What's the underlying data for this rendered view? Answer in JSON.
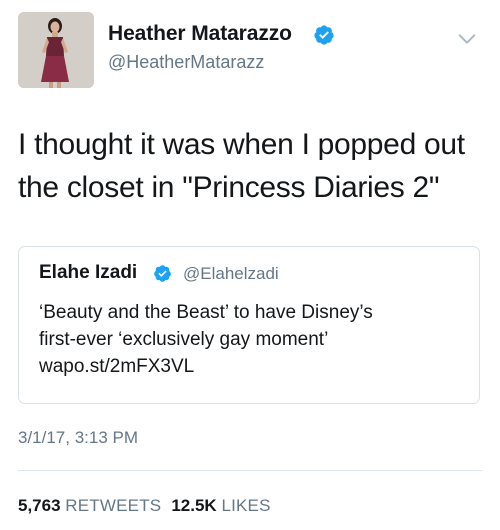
{
  "author": {
    "name": "Heather Matarazzo",
    "handle": "@HeatherMatarazz",
    "verified": true
  },
  "tweet": {
    "text": "I thought it was when I popped out\nthe closet in \"Princess Diaries 2\""
  },
  "quoted_tweet": {
    "name": "Elahe Izadi",
    "handle": "@Elahelzadi",
    "verified": true,
    "text": "‘Beauty and the Beast’ to have Disney’s\nfirst-ever ‘exclusively gay moment’\nwapo.st/2mFX3VL"
  },
  "timestamp": "3/1/17, 3:13 PM",
  "stats": {
    "retweets_count": "5,763",
    "retweets_label": "RETWEETS",
    "likes_count": "12.5K",
    "likes_label": "LIKES"
  },
  "colors": {
    "verified_blue": "#1da1f2",
    "secondary_text": "#657786",
    "primary_text": "#14171a",
    "border": "#d9e1e8"
  },
  "icons": {
    "verified": "verified-badge-icon",
    "menu": "chevron-down-icon"
  }
}
